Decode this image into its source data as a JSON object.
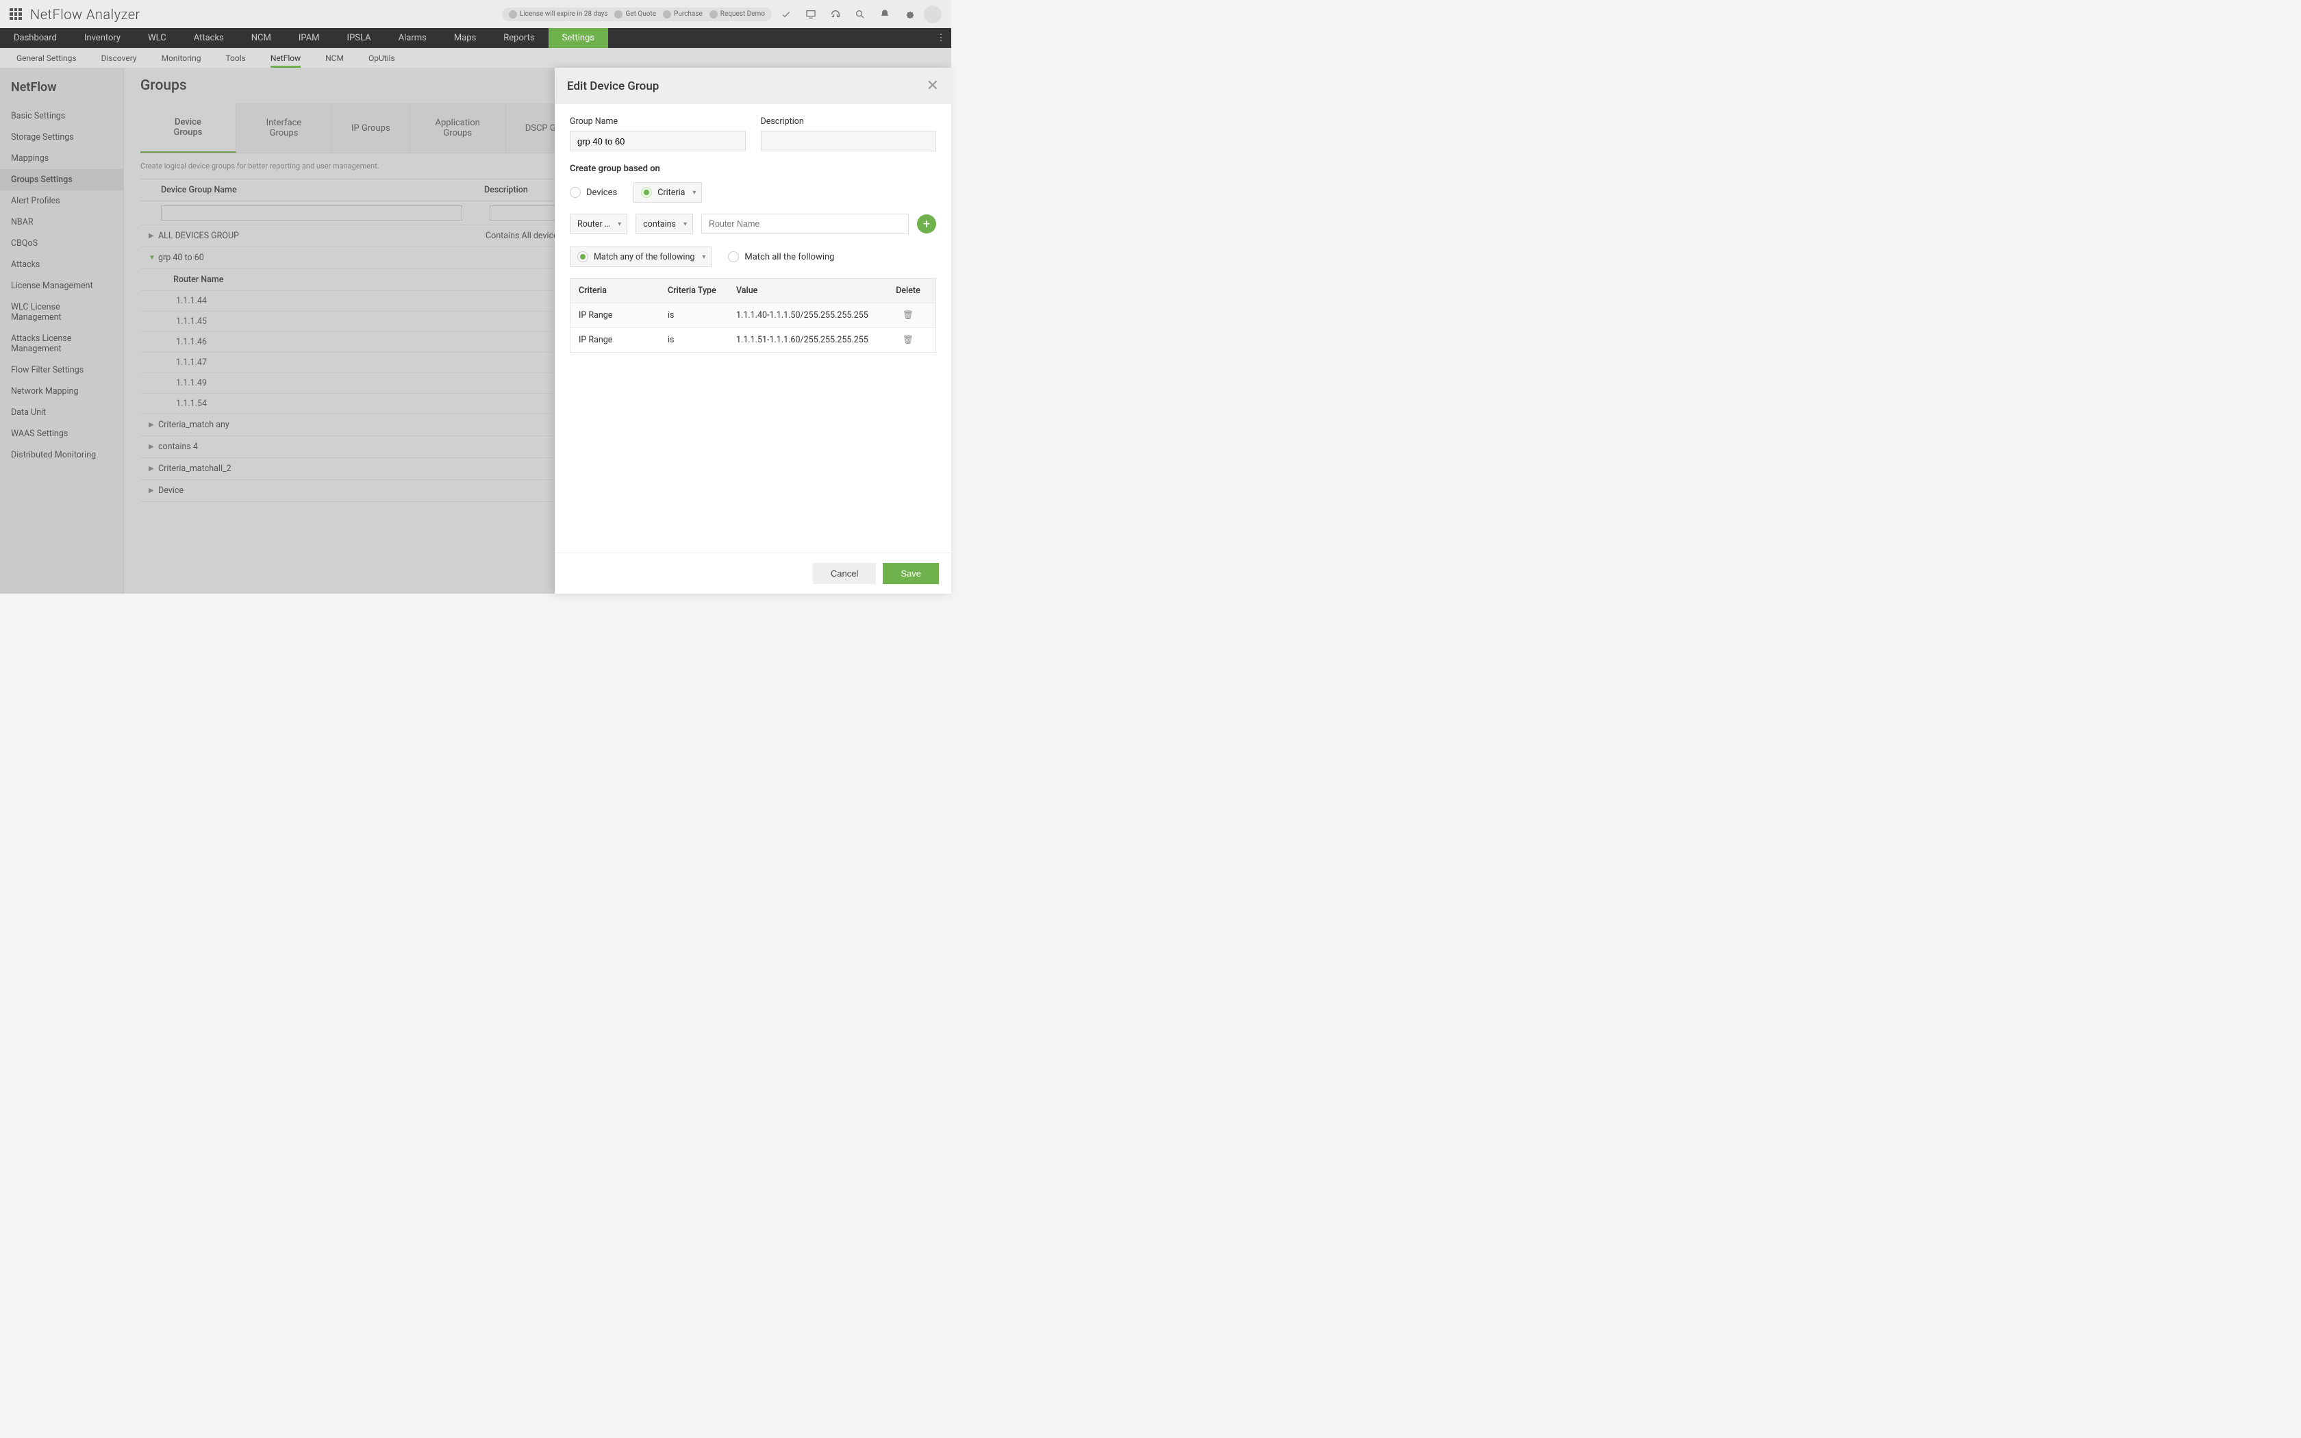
{
  "topbar": {
    "logo": "NetFlow Analyzer",
    "license_msg": "License will expire in 28 days",
    "get_quote": "Get Quote",
    "purchase": "Purchase",
    "request_demo": "Request Demo"
  },
  "mainnav": [
    "Dashboard",
    "Inventory",
    "WLC",
    "Attacks",
    "NCM",
    "IPAM",
    "IPSLA",
    "Alarms",
    "Maps",
    "Reports",
    "Settings"
  ],
  "mainnav_active": 10,
  "subnav": [
    "General Settings",
    "Discovery",
    "Monitoring",
    "Tools",
    "NetFlow",
    "NCM",
    "OpUtils"
  ],
  "subnav_active": 4,
  "sidebar": {
    "title": "NetFlow",
    "items": [
      "Basic Settings",
      "Storage Settings",
      "Mappings",
      "Groups Settings",
      "Alert Profiles",
      "NBAR",
      "CBQoS",
      "Attacks",
      "License Management",
      "WLC License Management",
      "Attacks License Management",
      "Flow Filter Settings",
      "Network Mapping",
      "Data Unit",
      "WAAS Settings",
      "Distributed Monitoring"
    ],
    "active": 3
  },
  "content": {
    "title": "Groups",
    "tabs": [
      "Device Groups",
      "Interface Groups",
      "IP Groups",
      "Application Groups",
      "DSCP Groups"
    ],
    "tab_active": 0,
    "helper": "Create logical device groups for better reporting and user management.",
    "col_name": "Device Group Name",
    "col_desc": "Description",
    "rows": [
      {
        "name": "ALL DEVICES GROUP",
        "desc": "Contains All devices",
        "expanded": false
      },
      {
        "name": "grp 40 to 60",
        "desc": "",
        "expanded": true
      },
      {
        "name": "Criteria_match any",
        "desc": "",
        "expanded": false
      },
      {
        "name": "contains 4",
        "desc": "",
        "expanded": false
      },
      {
        "name": "Criteria_matchall_2",
        "desc": "",
        "expanded": false
      },
      {
        "name": "Device",
        "desc": "",
        "expanded": false
      }
    ],
    "sub_header": "Router Name",
    "sub_rows": [
      "1.1.1.44",
      "1.1.1.45",
      "1.1.1.46",
      "1.1.1.47",
      "1.1.1.49",
      "1.1.1.54"
    ]
  },
  "panel": {
    "title": "Edit Device Group",
    "group_name_label": "Group Name",
    "group_name_value": "grp 40 to 60",
    "description_label": "Description",
    "description_value": "",
    "basis_label": "Create group based on",
    "basis_devices": "Devices",
    "basis_criteria": "Criteria",
    "builder": {
      "field": "Router …",
      "op": "contains",
      "placeholder": "Router Name"
    },
    "match_any": "Match any of the following",
    "match_all": "Match all the following",
    "table": {
      "h1": "Criteria",
      "h2": "Criteria Type",
      "h3": "Value",
      "h4": "Delete",
      "rows": [
        {
          "c": "IP Range",
          "t": "is",
          "v": "1.1.1.40-1.1.1.50/255.255.255.255"
        },
        {
          "c": "IP Range",
          "t": "is",
          "v": "1.1.1.51-1.1.1.60/255.255.255.255"
        }
      ]
    },
    "cancel": "Cancel",
    "save": "Save"
  }
}
